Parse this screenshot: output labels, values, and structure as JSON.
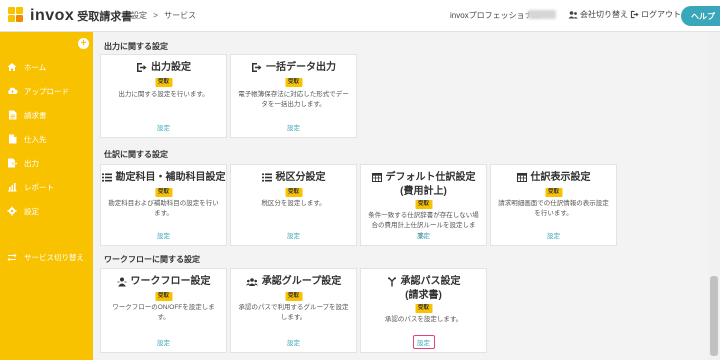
{
  "header": {
    "logo_text": "invox",
    "logo_sub": "受取請求書",
    "breadcrumb": [
      "設定",
      ">",
      "サービス"
    ],
    "user_name": "invoxプロフェッショナル",
    "switch_company": "会社切り替え",
    "logout": "ログアウト",
    "help": "ヘルプ"
  },
  "sidebar": {
    "collapse": "+",
    "items": [
      {
        "label": "ホーム",
        "icon": "home-icon"
      },
      {
        "label": "アップロード",
        "icon": "cloud-upload-icon"
      },
      {
        "label": "請求書",
        "icon": "document-icon"
      },
      {
        "label": "仕入先",
        "icon": "supplier-icon"
      },
      {
        "label": "出力",
        "icon": "output-icon"
      },
      {
        "label": "レポート",
        "icon": "chart-icon"
      },
      {
        "label": "設定",
        "icon": "gear-icon"
      },
      {
        "label": "サービス切り替え",
        "icon": "switch-icon"
      }
    ]
  },
  "sections": {
    "output": {
      "title": "出力に関する設定",
      "cards": [
        {
          "title": "出力設定",
          "badge": "受取",
          "desc": "出力に関する設定を行います。",
          "link": "設定"
        },
        {
          "title": "一括データ出力",
          "badge": "受取",
          "desc": "電子帳簿保存法に対応した形式でデータを一括出力します。",
          "link": "設定"
        }
      ]
    },
    "journal": {
      "title": "仕訳に関する設定",
      "cards": [
        {
          "title": "勘定科目・補助科目設定",
          "badge": "受取",
          "desc": "勘定科目および補助科目の設定を行います。",
          "link": "設定"
        },
        {
          "title": "税区分設定",
          "badge": "受取",
          "desc": "税区分を設定します。",
          "link": "設定"
        },
        {
          "title": "デフォルト仕訳設定",
          "title2": "(費用計上)",
          "badge": "受取",
          "desc": "条件一致する仕訳辞書が存在しない場合の費用計上仕訳ルールを設定します。",
          "link": "設定"
        },
        {
          "title": "仕訳表示設定",
          "badge": "受取",
          "desc": "請求明細画面での仕訳情報の表示設定を行います。",
          "link": "設定"
        }
      ]
    },
    "workflow": {
      "title": "ワークフローに関する設定",
      "cards": [
        {
          "title": "ワークフロー設定",
          "badge": "受取",
          "desc": "ワークフローのON/OFFを設定します。",
          "link": "設定"
        },
        {
          "title": "承認グループ設定",
          "badge": "受取",
          "desc": "承認のパスで利用するグループを設定します。",
          "link": "設定"
        },
        {
          "title": "承認パス設定",
          "title2": "(請求書)",
          "badge": "受取",
          "desc": "承認のパスを設定します。",
          "link": "設定"
        }
      ]
    }
  },
  "colors": {
    "brand_yellow": "#f9c200",
    "accent_teal": "#3aa6b9",
    "highlight_pink": "#e8417a"
  }
}
